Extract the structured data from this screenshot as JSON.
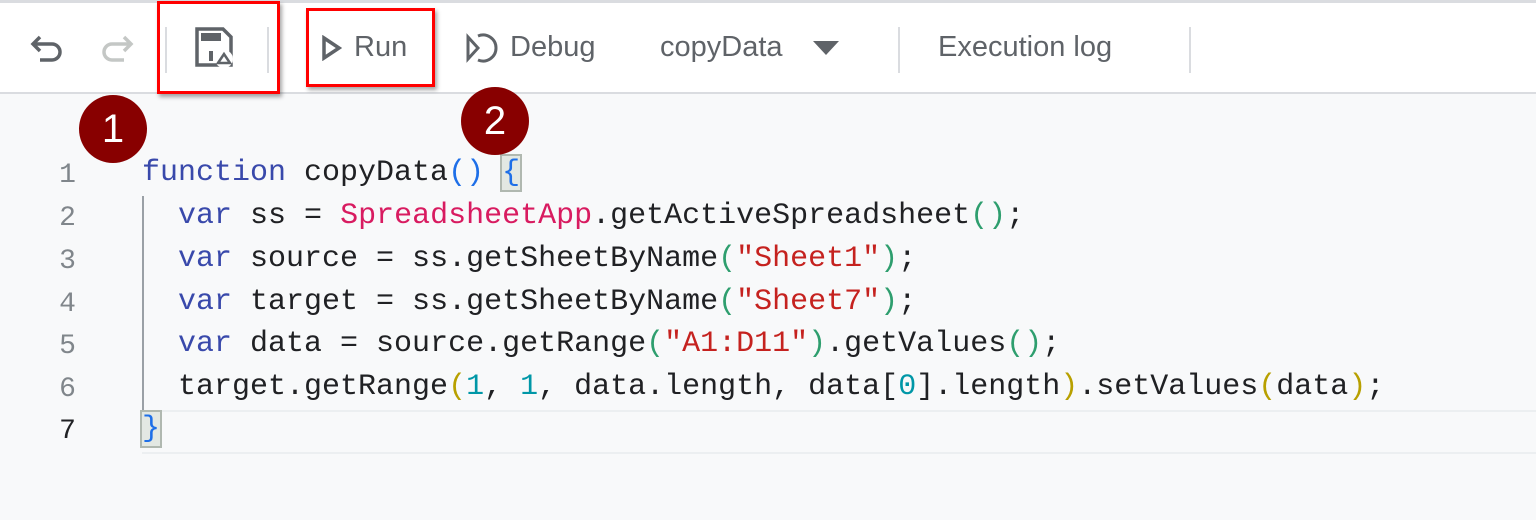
{
  "toolbar": {
    "run_label": "Run",
    "debug_label": "Debug",
    "function_select": "copyData",
    "execution_log_label": "Execution log"
  },
  "annotations": [
    "1",
    "2"
  ],
  "colors": {
    "highlight": "#ff0000",
    "badge": "#880000"
  },
  "editor": {
    "line_numbers": [
      "1",
      "2",
      "3",
      "4",
      "5",
      "6",
      "7"
    ],
    "lines": [
      [
        [
          "function",
          "kw"
        ],
        [
          " copyData",
          ""
        ],
        [
          "()",
          "p1"
        ],
        [
          " ",
          ""
        ],
        [
          "{",
          "p1 bm"
        ]
      ],
      [
        [
          "  ",
          ""
        ],
        [
          "var",
          "kw"
        ],
        [
          " ss = ",
          ""
        ],
        [
          "SpreadsheetApp",
          "cls"
        ],
        [
          ".getActiveSpreadsheet",
          ""
        ],
        [
          "()",
          "p2"
        ],
        [
          ";",
          ""
        ]
      ],
      [
        [
          "  ",
          ""
        ],
        [
          "var",
          "kw"
        ],
        [
          " source = ss.getSheetByName",
          ""
        ],
        [
          "(",
          "p2"
        ],
        [
          "\"Sheet1\"",
          "str"
        ],
        [
          ")",
          "p2"
        ],
        [
          ";",
          ""
        ]
      ],
      [
        [
          "  ",
          ""
        ],
        [
          "var",
          "kw"
        ],
        [
          " target = ss.getSheetByName",
          ""
        ],
        [
          "(",
          "p2"
        ],
        [
          "\"Sheet7\"",
          "str"
        ],
        [
          ")",
          "p2"
        ],
        [
          ";",
          ""
        ]
      ],
      [
        [
          "  ",
          ""
        ],
        [
          "var",
          "kw"
        ],
        [
          " data = source.getRange",
          ""
        ],
        [
          "(",
          "p2"
        ],
        [
          "\"A1:D11\"",
          "str"
        ],
        [
          ")",
          "p2"
        ],
        [
          ".getValues",
          ""
        ],
        [
          "()",
          "p2"
        ],
        [
          ";",
          ""
        ]
      ],
      [
        [
          "  target.getRange",
          ""
        ],
        [
          "(",
          "p3"
        ],
        [
          "1",
          "num"
        ],
        [
          ", ",
          ""
        ],
        [
          "1",
          "num"
        ],
        [
          ", data.length, data[",
          ""
        ],
        [
          "0",
          "num"
        ],
        [
          "].length",
          ""
        ],
        [
          ")",
          "p3"
        ],
        [
          ".setValues",
          ""
        ],
        [
          "(",
          "p3"
        ],
        [
          "data",
          ""
        ],
        [
          ")",
          "p3"
        ],
        [
          ";",
          ""
        ]
      ],
      [
        [
          "}",
          "p1 bm"
        ]
      ]
    ]
  }
}
